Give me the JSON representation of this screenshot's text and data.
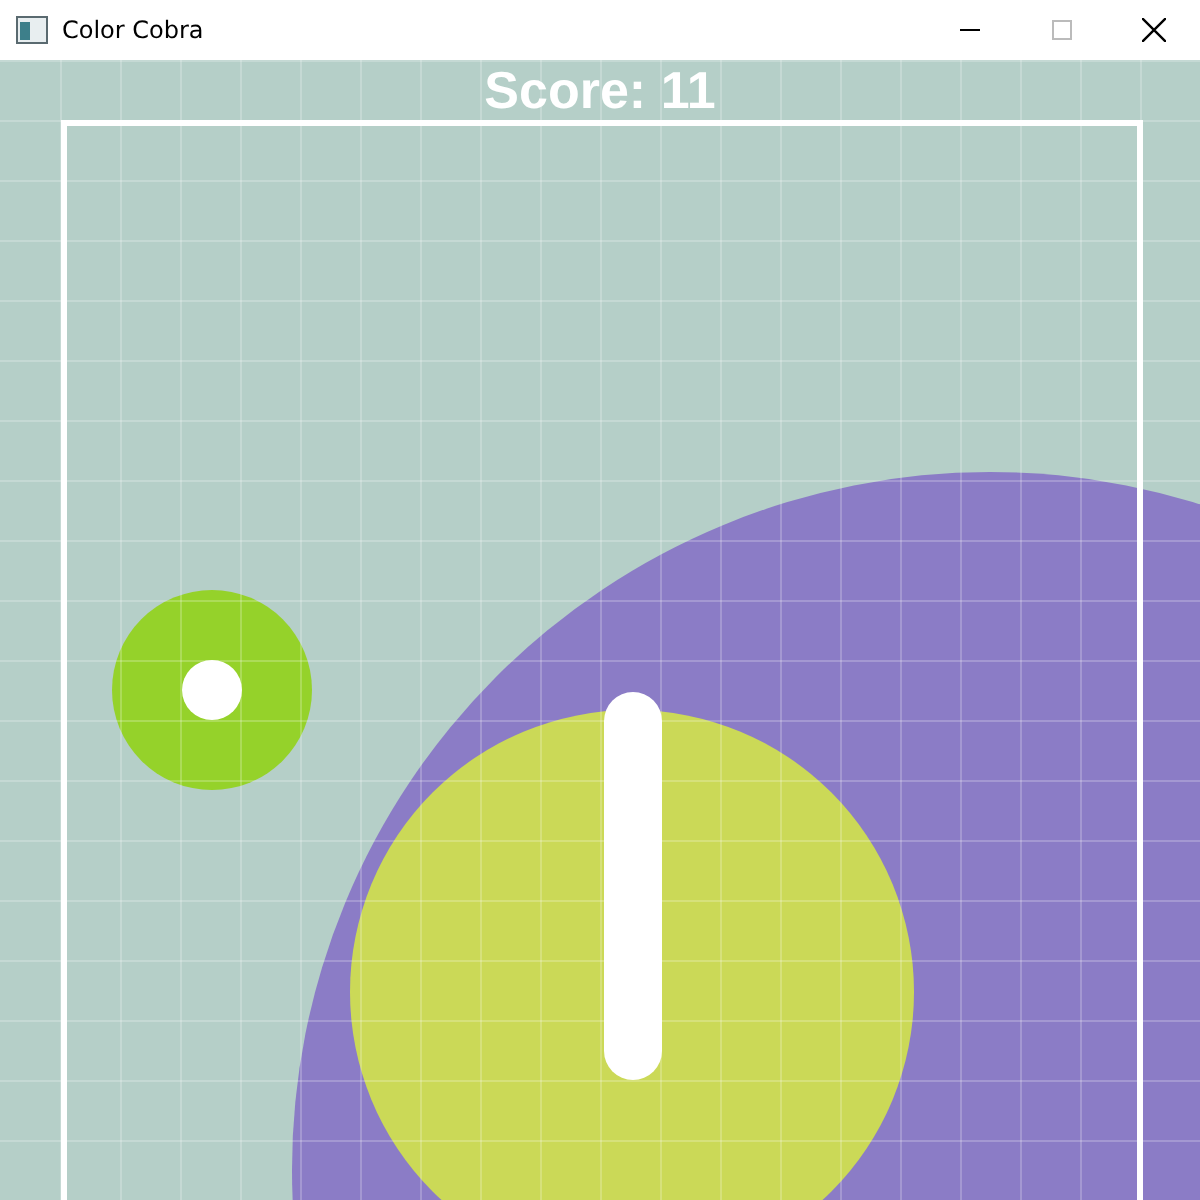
{
  "window": {
    "title": "Color Cobra"
  },
  "hud": {
    "score": "Score: 11"
  }
}
